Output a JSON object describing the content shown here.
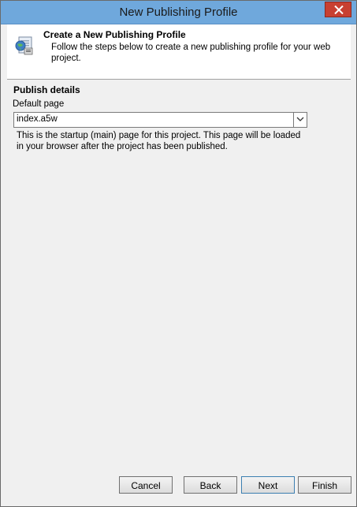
{
  "window": {
    "title": "New Publishing Profile"
  },
  "header": {
    "title": "Create a New Publishing Profile",
    "description": "Follow the steps below to create a new publishing profile for your web project."
  },
  "section": {
    "title": "Publish details",
    "default_page_label": "Default page",
    "default_page_value": "index.a5w",
    "help_text": "This is the startup (main) page for this project. This page will be loaded in your browser after the project has been published."
  },
  "buttons": {
    "cancel": "Cancel",
    "back": "Back",
    "next": "Next",
    "finish": "Finish"
  },
  "colors": {
    "titlebar": "#6fa8dc",
    "close_button": "#c84031",
    "dialog_background": "#f0f0f0"
  },
  "icons": {
    "header": "web-publish-icon",
    "close": "close-icon",
    "dropdown": "chevron-down-icon"
  }
}
